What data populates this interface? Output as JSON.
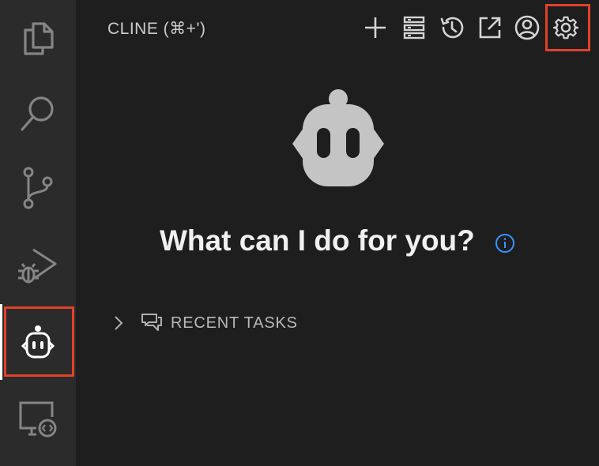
{
  "panel": {
    "title": "CLINE (⌘+')"
  },
  "activity_bar": {
    "items": [
      {
        "icon": "files-icon"
      },
      {
        "icon": "search-icon"
      },
      {
        "icon": "source-control-icon"
      },
      {
        "icon": "run-debug-icon"
      },
      {
        "icon": "cline-robot-icon",
        "active": true
      },
      {
        "icon": "remote-explorer-icon"
      }
    ]
  },
  "toolbar": {
    "buttons": [
      {
        "icon": "plus-icon"
      },
      {
        "icon": "mcp-servers-icon"
      },
      {
        "icon": "history-icon"
      },
      {
        "icon": "open-in-editor-icon"
      },
      {
        "icon": "account-icon"
      },
      {
        "icon": "gear-icon",
        "highlighted": true
      }
    ]
  },
  "welcome": {
    "headline": "What can I do for you?"
  },
  "recent_tasks": {
    "label": "RECENT TASKS"
  },
  "colors": {
    "background": "#1e1e1e",
    "activity_bar": "#2b2b2b",
    "highlight": "#e2412a",
    "info_accent": "#3794ff",
    "robot": "#c4c4c4"
  }
}
